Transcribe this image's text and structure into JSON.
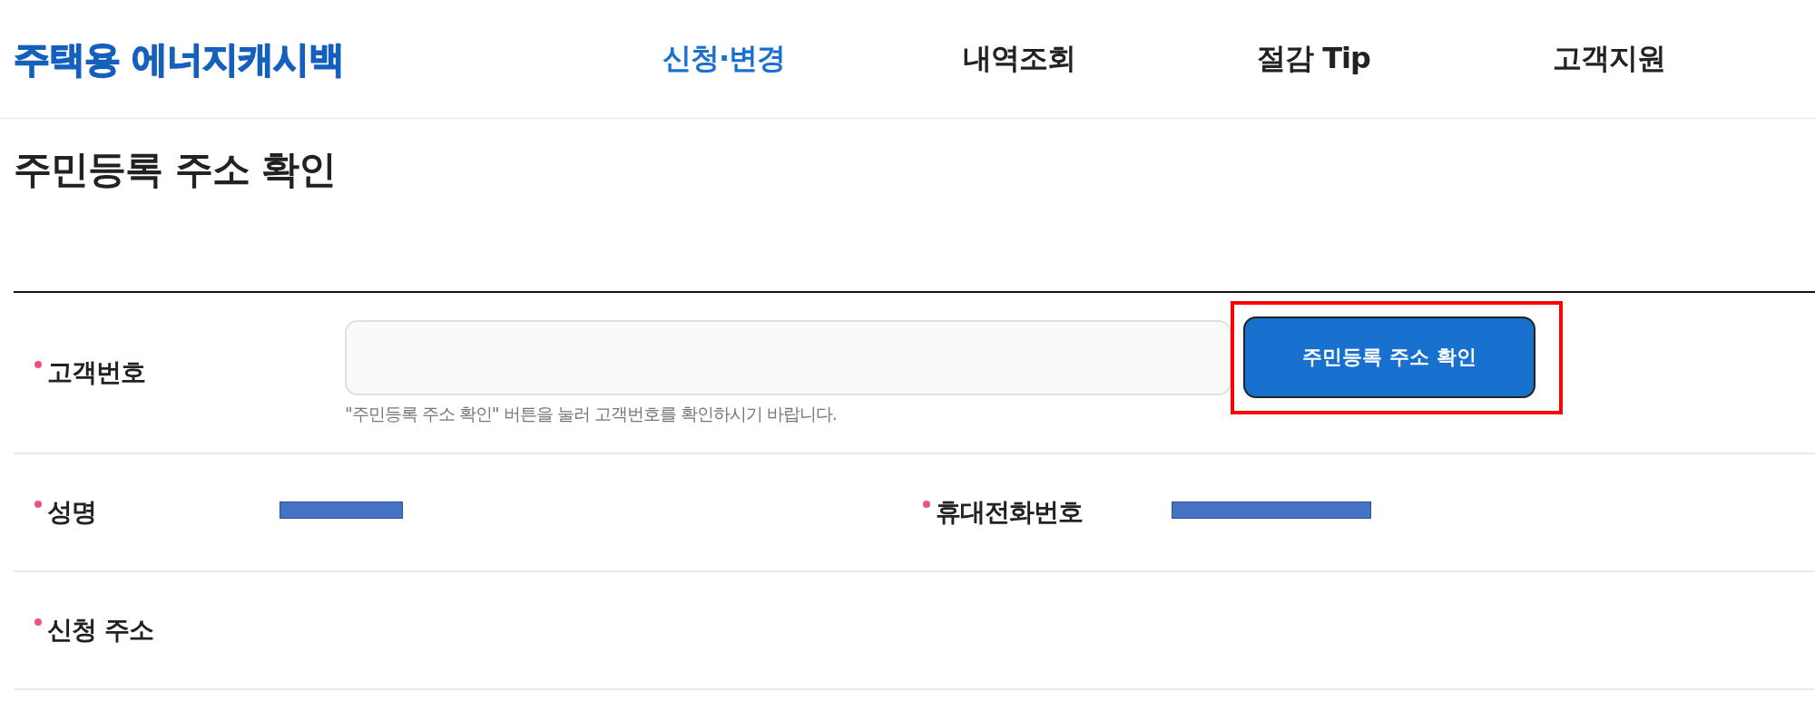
{
  "header": {
    "logo": "주택용 에너지캐시백",
    "nav": [
      {
        "label": "신청·변경",
        "selected": true
      },
      {
        "label": "내역조회",
        "selected": false
      },
      {
        "label": "절감 Tip",
        "selected": false
      },
      {
        "label": "고객지원",
        "selected": false
      }
    ]
  },
  "page_title": "주민등록 주소 확인",
  "form": {
    "rows": [
      {
        "fields": [
          {
            "label": "고객번호",
            "required": true,
            "kind": "input",
            "hint": "\"주민등록 주소 확인\" 버튼을 눌러 고객번호를 확인하시기 바랍니다.",
            "button": {
              "label": "주민등록 주소 확인",
              "highlighted": true
            }
          }
        ]
      },
      {
        "fields": [
          {
            "label": "성명",
            "required": true,
            "kind": "redacted"
          },
          {
            "label": "휴대전화번호",
            "required": true,
            "kind": "redacted"
          }
        ]
      },
      {
        "fields": [
          {
            "label": "신청 주소",
            "required": true,
            "kind": "empty"
          }
        ]
      }
    ]
  }
}
